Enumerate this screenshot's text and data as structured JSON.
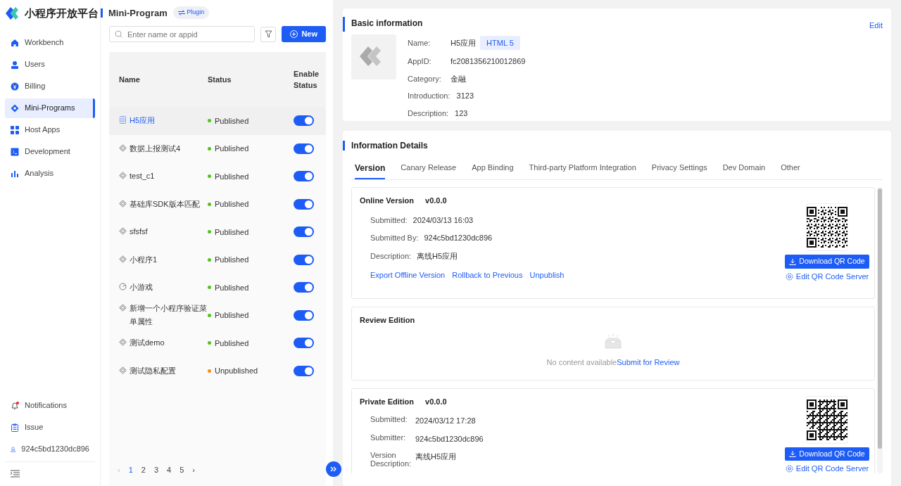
{
  "brand": {
    "title": "小程序开放平台"
  },
  "sidebar": {
    "items": [
      {
        "label": "Workbench",
        "selected": false
      },
      {
        "label": "Users",
        "selected": false
      },
      {
        "label": "Billing",
        "selected": false
      },
      {
        "label": "Mini-Programs",
        "selected": true
      },
      {
        "label": "Host Apps",
        "selected": false
      },
      {
        "label": "Development",
        "selected": false
      },
      {
        "label": "Analysis",
        "selected": false
      }
    ],
    "footer": [
      {
        "label": "Notifications",
        "alert": true
      },
      {
        "label": "Issue",
        "alert": false
      },
      {
        "label": "924c5bd1230dc896",
        "alert": false
      }
    ]
  },
  "list_panel": {
    "title": "Mini-Program",
    "tag": "Plugin",
    "search": {
      "placeholder": "Enter name or appid"
    },
    "new_button": "New",
    "columns": [
      "Name",
      "Status",
      "Enable Status"
    ],
    "rows": [
      {
        "name": "H5应用",
        "kind": "web",
        "status": "Published",
        "color": "#52c41a",
        "enabled": true,
        "selected": true
      },
      {
        "name": "数据上报测试4",
        "kind": "mini",
        "status": "Published",
        "color": "#52c41a",
        "enabled": true,
        "selected": false
      },
      {
        "name": "test_c1",
        "kind": "mini",
        "status": "Published",
        "color": "#52c41a",
        "enabled": true,
        "selected": false
      },
      {
        "name": "基础库SDK版本匹配",
        "kind": "mini",
        "status": "Published",
        "color": "#52c41a",
        "enabled": true,
        "selected": false
      },
      {
        "name": "sfsfsf",
        "kind": "mini",
        "status": "Published",
        "color": "#52c41a",
        "enabled": true,
        "selected": false
      },
      {
        "name": "小程序1",
        "kind": "mini",
        "status": "Published",
        "color": "#52c41a",
        "enabled": true,
        "selected": false
      },
      {
        "name": "小游戏",
        "kind": "game",
        "status": "Published",
        "color": "#52c41a",
        "enabled": true,
        "selected": false
      },
      {
        "name": "新增一个小程序验证菜单属性",
        "kind": "mini",
        "status": "Published",
        "color": "#52c41a",
        "enabled": true,
        "selected": false
      },
      {
        "name": "测试demo",
        "kind": "mini",
        "status": "Published",
        "color": "#52c41a",
        "enabled": true,
        "selected": false
      },
      {
        "name": "测试隐私配置",
        "kind": "mini",
        "status": "Unpublished",
        "color": "#fa8c16",
        "enabled": true,
        "selected": false
      }
    ],
    "pagination": {
      "prev": "‹",
      "next": "›",
      "pages": [
        {
          "label": "1",
          "selected": true
        },
        {
          "label": "2",
          "selected": false
        },
        {
          "label": "3",
          "selected": false
        },
        {
          "label": "4",
          "selected": false
        },
        {
          "label": "5",
          "selected": false
        }
      ]
    }
  },
  "basic_info": {
    "title": "Basic information",
    "edit": "Edit",
    "fields": [
      {
        "label": "Name:",
        "value": "H5应用",
        "tag": "HTML 5"
      },
      {
        "label": "AppID:",
        "value": "fc2081356210012869"
      },
      {
        "label": "Category:",
        "value": "金融"
      },
      {
        "label": "Introduction:",
        "value": "3123"
      },
      {
        "label": "Description:",
        "value": "123"
      }
    ]
  },
  "details": {
    "title": "Information Details",
    "tabs": [
      {
        "label": "Version",
        "selected": true
      },
      {
        "label": "Canary Release",
        "selected": false
      },
      {
        "label": "App Binding",
        "selected": false
      },
      {
        "label": "Third-party Platform Integration",
        "selected": false
      },
      {
        "label": "Privacy Settings",
        "selected": false
      },
      {
        "label": "Dev Domain",
        "selected": false
      },
      {
        "label": "Other",
        "selected": false
      }
    ],
    "sections": [
      {
        "kind": "online",
        "title": "Online Version",
        "version": "v0.0.0",
        "fields": [
          {
            "label": "Submitted:",
            "value": "2024/03/13 16:03"
          },
          {
            "label": "Submitted By:",
            "value": "924c5bd1230dc896"
          },
          {
            "label": "Description:",
            "value": "离线H5应用"
          }
        ],
        "actions": [
          "Export Offline Version",
          "Rollback to Previous",
          "Unpublish"
        ],
        "qr": {
          "download": "Download QR Code",
          "edit": "Edit QR Code Server"
        }
      },
      {
        "kind": "review",
        "title": "Review Edition",
        "empty_text": "No content available",
        "action": "Submit for Review"
      },
      {
        "kind": "private",
        "title": "Private Edition",
        "version": "v0.0.0",
        "fields": [
          {
            "label": "Submitted:",
            "value": "2024/03/12 17:28"
          },
          {
            "label": "Submitter:",
            "value": "924c5bd1230dc896"
          },
          {
            "label": "Version Description:",
            "value": "离线H5应用"
          }
        ],
        "qr": {
          "download": "Download QR Code",
          "edit": "Edit QR Code Server"
        }
      }
    ]
  }
}
